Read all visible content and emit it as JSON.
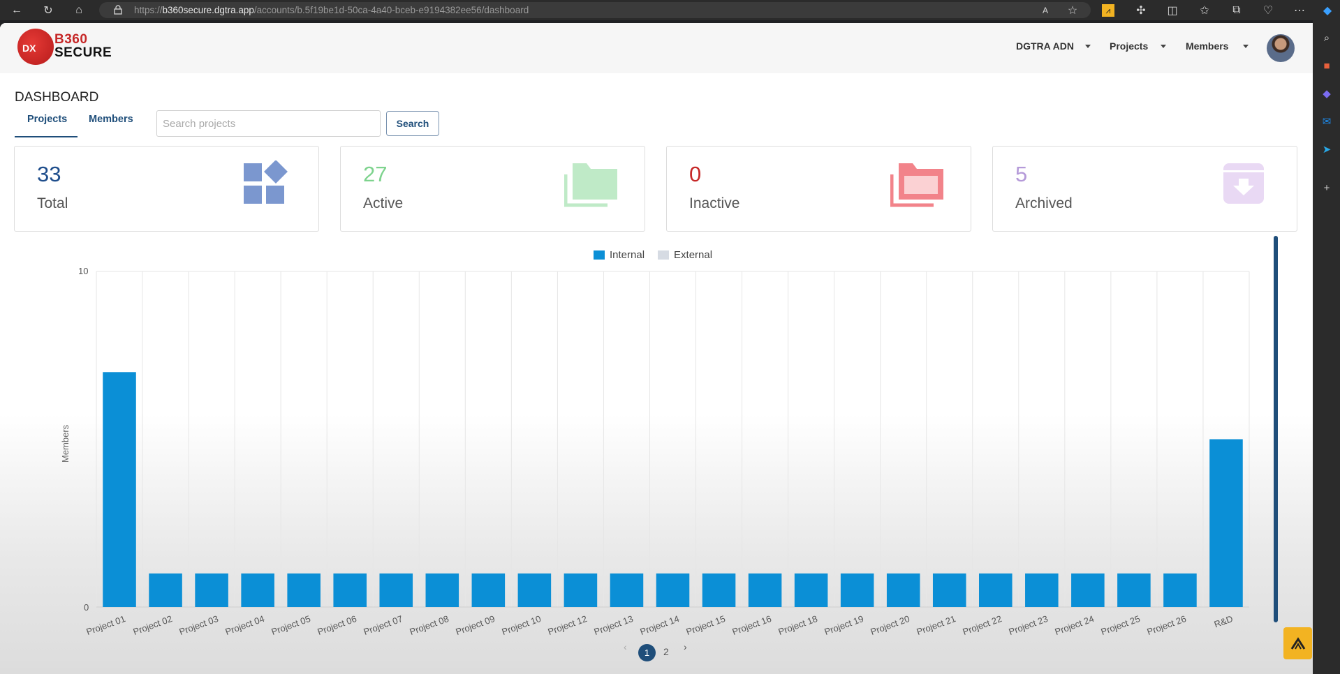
{
  "browser": {
    "url_host": "b360secure.dgtra.app",
    "url_prefix": "https://",
    "url_path": "/accounts/b.5f19be1d-50ca-4a40-bceb-e9194382ee56/dashboard"
  },
  "brand": {
    "logo_dx": "DX",
    "logo_line1": "B360",
    "logo_line2": "SECURE"
  },
  "nav": {
    "account": "DGTRA ADN",
    "projects": "Projects",
    "members": "Members"
  },
  "page_title": "DASHBOARD",
  "tabs": [
    {
      "label": "Projects",
      "active": true
    },
    {
      "label": "Members",
      "active": false
    }
  ],
  "search": {
    "placeholder": "Search projects",
    "value": "",
    "button": "Search"
  },
  "cards": [
    {
      "value": "33",
      "label": "Total",
      "color": "#1f4e8c",
      "icon": "shapes-icon"
    },
    {
      "value": "27",
      "label": "Active",
      "color": "#7ed38e",
      "icon": "folders-icon"
    },
    {
      "value": "0",
      "label": "Inactive",
      "color": "#c62828",
      "icon": "folders-open-icon"
    },
    {
      "value": "5",
      "label": "Archived",
      "color": "#b59ad9",
      "icon": "archive-icon"
    }
  ],
  "chart_data": {
    "type": "bar",
    "ylabel": "Members",
    "ylim": [
      0,
      10
    ],
    "yticks": [
      "0",
      "10"
    ],
    "legend_position": "top-center",
    "grid": true,
    "categories": [
      "Project 01",
      "Project 02",
      "Project 03",
      "Project 04",
      "Project 05",
      "Project 06",
      "Project 07",
      "Project 08",
      "Project 09",
      "Project 10",
      "Project 12",
      "Project 13",
      "Project 14",
      "Project 15",
      "Project 16",
      "Project 18",
      "Project 19",
      "Project 20",
      "Project 21",
      "Project 22",
      "Project 23",
      "Project 24",
      "Project 25",
      "Project 26",
      "R&D"
    ],
    "series": [
      {
        "name": "Internal",
        "color": "#0b8fd6",
        "values": [
          7,
          1,
          1,
          1,
          1,
          1,
          1,
          1,
          1,
          1,
          1,
          1,
          1,
          1,
          1,
          1,
          1,
          1,
          1,
          1,
          1,
          1,
          1,
          1,
          5
        ]
      },
      {
        "name": "External",
        "color": "#d6dbe3",
        "values": [
          0,
          0,
          0,
          0,
          0,
          0,
          0,
          0,
          0,
          0,
          0,
          0,
          0,
          0,
          0,
          0,
          0,
          0,
          0,
          0,
          0,
          0,
          0,
          0,
          0
        ]
      }
    ]
  },
  "pagination": {
    "pages": [
      "1",
      "2"
    ],
    "current": "1",
    "prev": "‹",
    "next": "›"
  }
}
